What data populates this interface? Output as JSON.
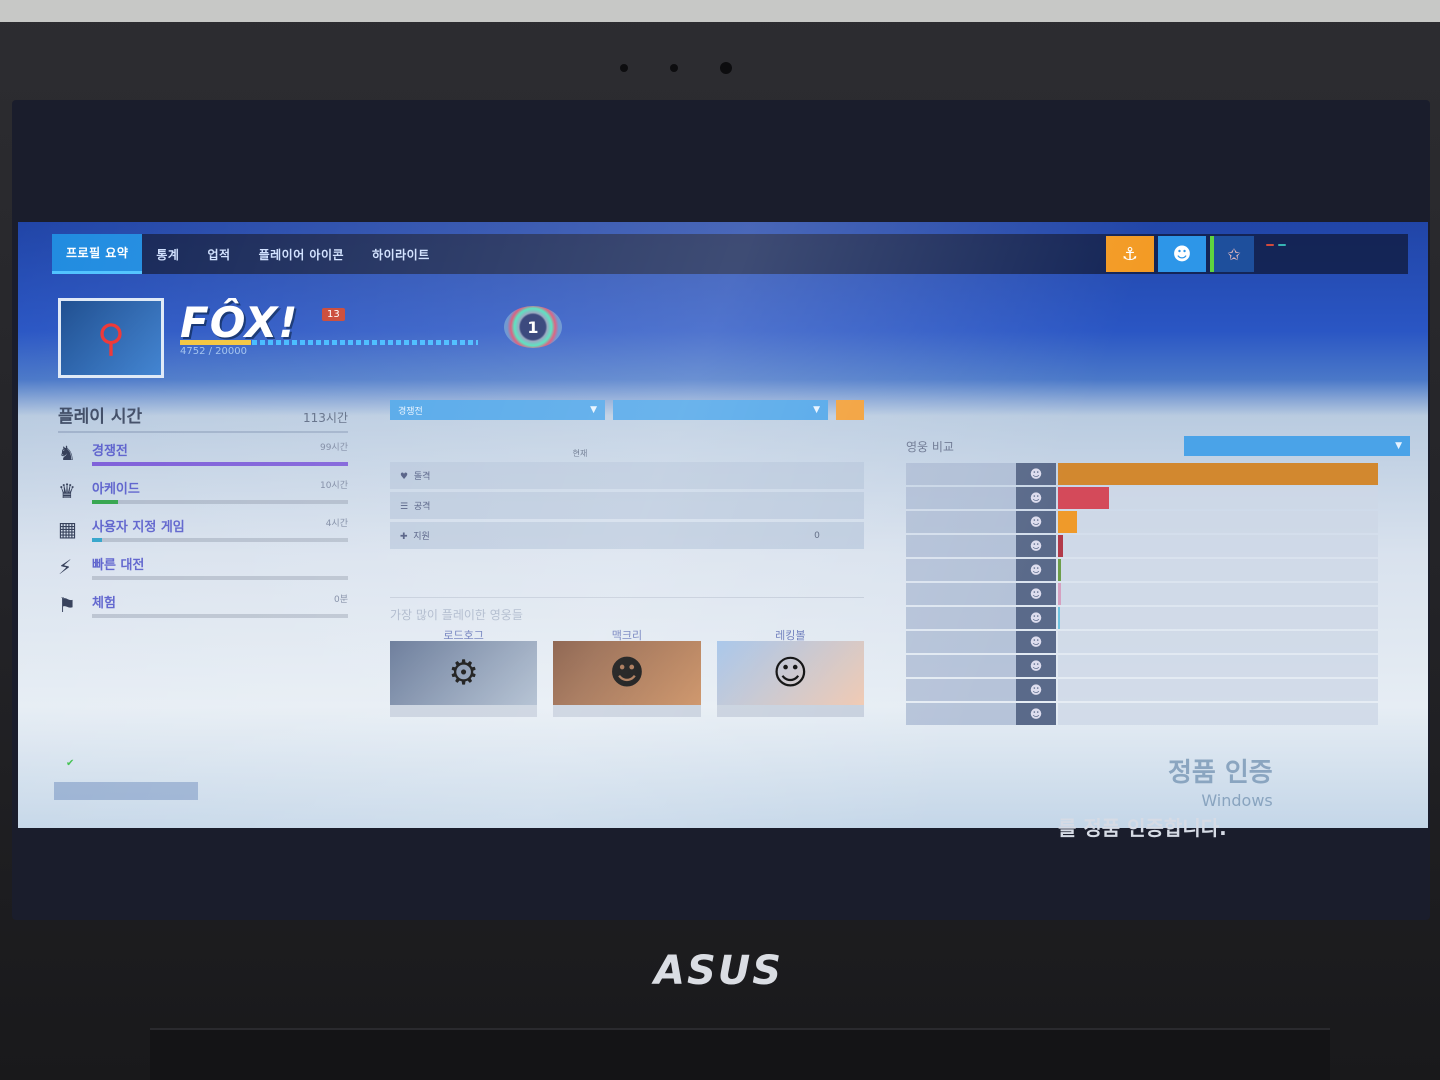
{
  "nav": {
    "tabs": [
      "프로필 요약",
      "통계",
      "업적",
      "플레이어 아이콘",
      "하이라이트"
    ],
    "active": 0,
    "user_line1": "",
    "pills": [
      "",
      ""
    ]
  },
  "profile": {
    "name": "FÔX!",
    "level": "13",
    "xp_text": "4752 / 20000",
    "xp_fraction": 0.2376,
    "rank_number": "1"
  },
  "playtime": {
    "title": "플레이 시간",
    "total": "113시간",
    "modes": [
      {
        "label": "경쟁전",
        "hours": "99시간",
        "icon": "competitive-icon",
        "fill": 1.0,
        "color": "#7b5bd8"
      },
      {
        "label": "아케이드",
        "hours": "10시간",
        "icon": "arcade-icon",
        "fill": 0.1,
        "color": "#2fa34a"
      },
      {
        "label": "사용자 지정 게임",
        "hours": "4시간",
        "icon": "custom-game-icon",
        "fill": 0.04,
        "color": "#2fa3c9"
      },
      {
        "label": "빠른 대전",
        "hours": "",
        "icon": "quick-play-icon",
        "fill": 0.0,
        "color": "#2fa3c9"
      },
      {
        "label": "체험",
        "hours": "0분",
        "icon": "training-icon",
        "fill": 0.0,
        "color": "#2fa3c9"
      }
    ]
  },
  "filters": {
    "mode_select": "경쟁전",
    "season_select": "",
    "button": ""
  },
  "stats": {
    "headers": [
      "",
      "현재",
      "",
      ""
    ],
    "rows": [
      {
        "role": "돌격",
        "current": "",
        "peak": "",
        "games": "",
        "icon": "tank-icon"
      },
      {
        "role": "공격",
        "current": "",
        "peak": "",
        "games": "",
        "icon": "damage-icon"
      },
      {
        "role": "지원",
        "current": "",
        "peak": "",
        "games": "0",
        "icon": "support-icon"
      }
    ]
  },
  "top_heroes": {
    "title": "가장 많이 플레이한 영웅들",
    "heroes": [
      {
        "name": "로드호그",
        "time": "",
        "icon": "roadhog-icon"
      },
      {
        "name": "맥크리",
        "time": "",
        "icon": "mccree-icon"
      },
      {
        "name": "레킹볼",
        "time": "",
        "icon": "wrecking-ball-icon"
      }
    ]
  },
  "compare": {
    "title": "영웅 비교",
    "select": "",
    "rows": [
      {
        "name": "",
        "value": "",
        "fill": 1.0,
        "color": "#d2882f"
      },
      {
        "name": "",
        "value": "",
        "fill": 0.16,
        "color": "#d44a5a"
      },
      {
        "name": "",
        "value": "",
        "fill": 0.06,
        "color": "#ef9a2a"
      },
      {
        "name": "",
        "value": "",
        "fill": 0.015,
        "color": "#b23a4a"
      },
      {
        "name": "",
        "value": "",
        "fill": 0.008,
        "color": "#6d9e4a"
      },
      {
        "name": "",
        "value": "",
        "fill": 0.008,
        "color": "#d5a0c0"
      },
      {
        "name": "",
        "value": "",
        "fill": 0.006,
        "color": "#6fc3e0"
      },
      {
        "name": "",
        "value": "",
        "fill": 0.0,
        "color": "#aaa"
      },
      {
        "name": "",
        "value": "",
        "fill": 0.0,
        "color": "#aaa"
      },
      {
        "name": "",
        "value": "",
        "fill": 0.0,
        "color": "#aaa"
      },
      {
        "name": "",
        "value": "",
        "fill": 0.0,
        "color": "#aaa"
      }
    ]
  },
  "footer": {
    "note": "",
    "button": ""
  },
  "windows": {
    "activation_title": "정품 인증",
    "activation_sub": "Windows",
    "activation_line2": "를 정품 인증합니다."
  },
  "laptop": {
    "brand": "ASUS"
  }
}
